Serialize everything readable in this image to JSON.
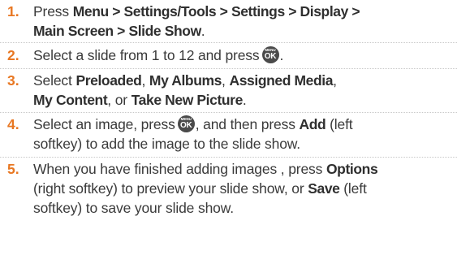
{
  "ok_icon": {
    "top": "MENU",
    "bottom": "OK"
  },
  "steps": [
    {
      "number": "1.",
      "line1": {
        "t1": "Press ",
        "b1": "Menu > Settings/Tools > Settings > Display >"
      },
      "line2": {
        "b1": "Main Screen > Slide Show",
        "t1": "."
      }
    },
    {
      "number": "2.",
      "line1": {
        "t1": "Select a slide from 1 to 12 and press",
        "t2": "."
      }
    },
    {
      "number": "3.",
      "line1": {
        "t1": "Select ",
        "b1": "Preloaded",
        "t2": ", ",
        "b2": "My Albums",
        "t3": ", ",
        "b3": "Assigned Media",
        "t4": ","
      },
      "line2": {
        "b1": "My Content",
        "t1": ", or ",
        "b2": "Take New Picture",
        "t2": "."
      }
    },
    {
      "number": "4.",
      "line1": {
        "t1": "Select an image, press",
        "t2": ", and then press ",
        "b1": "Add",
        "t3": " (left"
      },
      "line2": {
        "t1": "softkey) to add the image to the slide show."
      }
    },
    {
      "number": "5.",
      "line1": {
        "t1": "When you have finished adding images , press ",
        "b1": "Options"
      },
      "line2": {
        "t1": "(right softkey) to preview your slide show, or ",
        "b1": "Save",
        "t2": " (left"
      },
      "line3": {
        "t1": "softkey) to save your slide show."
      }
    }
  ]
}
